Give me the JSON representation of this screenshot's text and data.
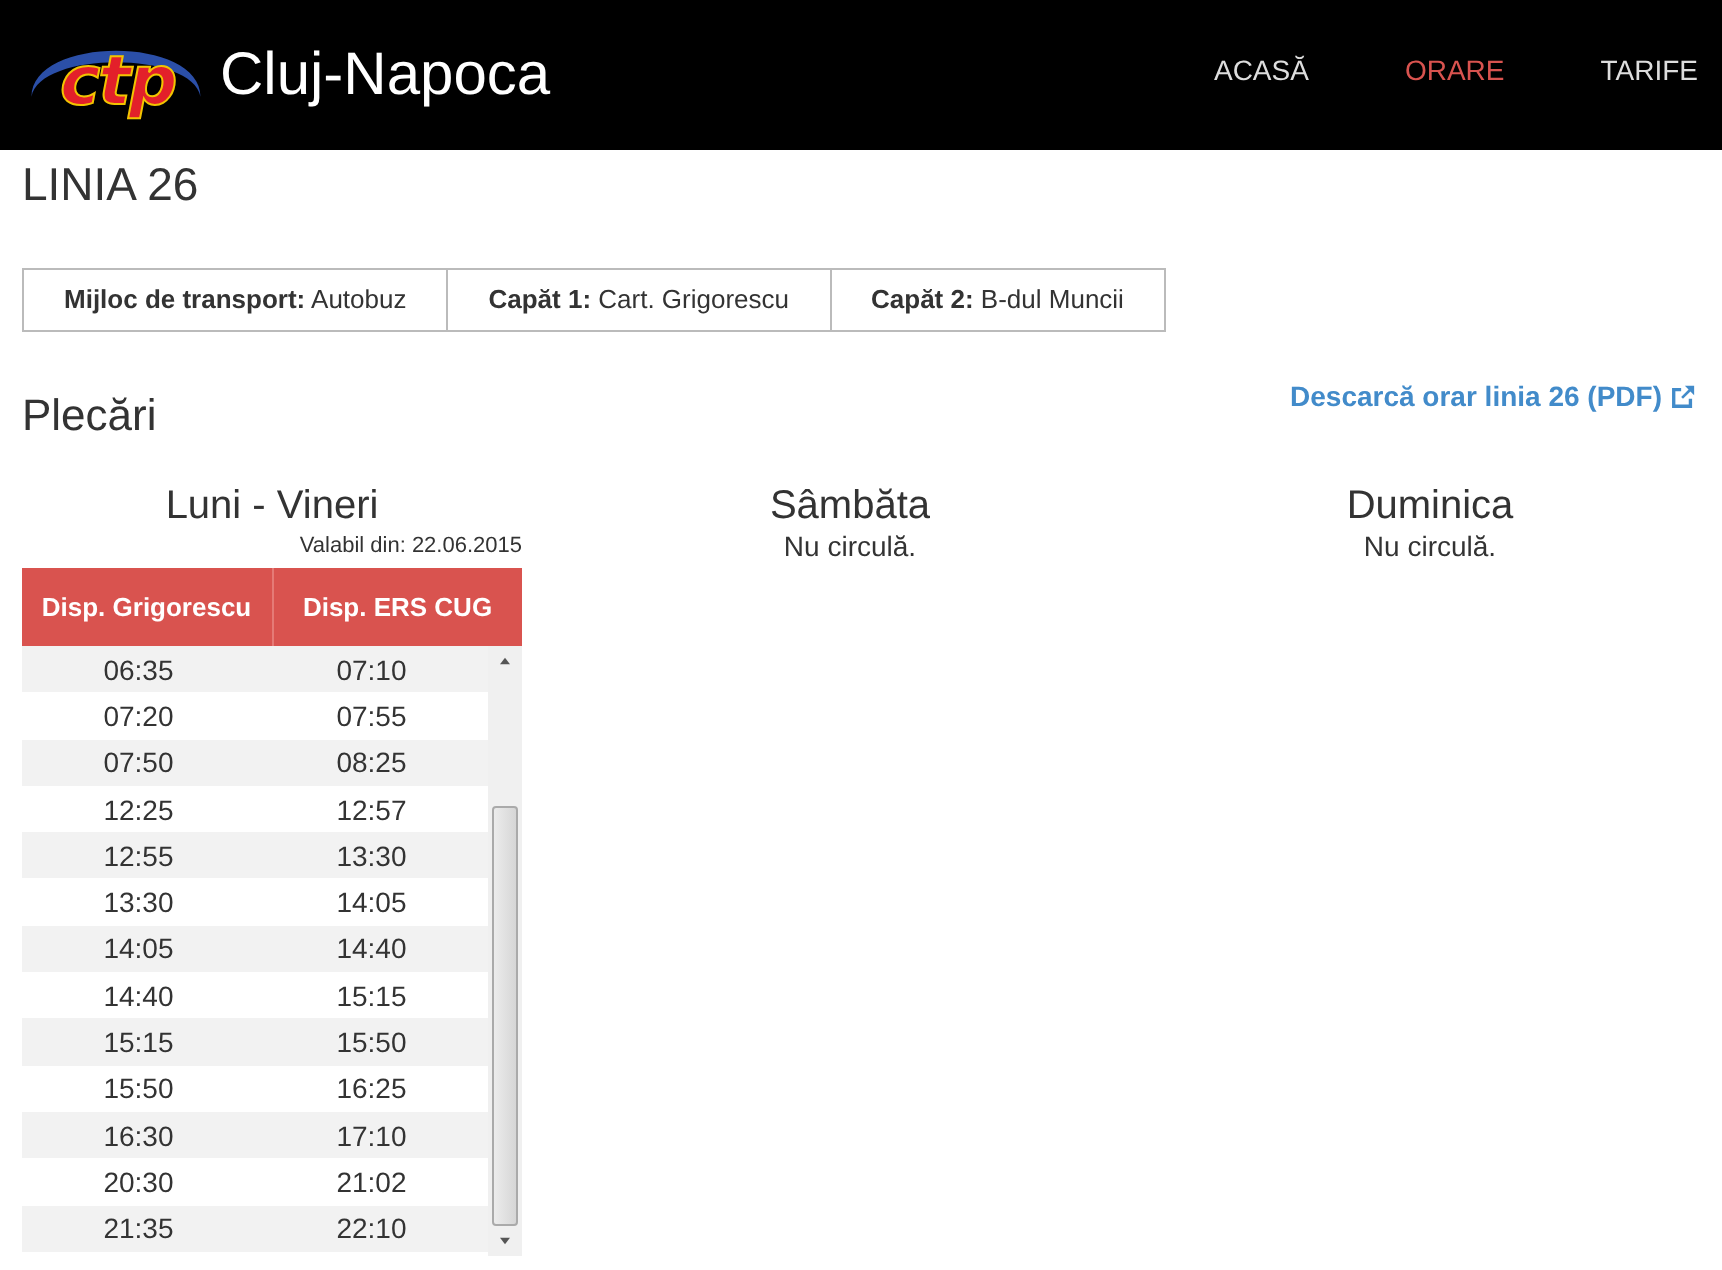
{
  "header": {
    "logo_text": "ctp",
    "brand": "Cluj-Napoca",
    "nav": [
      {
        "label": "ACASĂ",
        "selected": false
      },
      {
        "label": "ORARE",
        "selected": true
      },
      {
        "label": "TARIFE",
        "selected": false
      }
    ]
  },
  "title": "LINIA 26",
  "info": [
    "**Mijloc de transport:** Autobuz",
    "**Capăt 1:** Cart. Grigorescu",
    "**Capăt 2:** B-dul Muncii"
  ],
  "departures": {
    "heading": "Plecări",
    "download_link": "Descarcă orar linia 26 (PDF)",
    "days": [
      {
        "kind": "table",
        "name": "Luni - Vineri",
        "valid_from": "Valabil din: 22.06.2015",
        "columns": [
          "Disp. Grigorescu",
          "Disp. ERS CUG"
        ],
        "rows": [
          [
            "06:35",
            "07:10"
          ],
          [
            "07:20",
            "07:55"
          ],
          [
            "07:50",
            "08:25"
          ],
          [
            "12:25",
            "12:57"
          ],
          [
            "12:55",
            "13:30"
          ],
          [
            "13:30",
            "14:05"
          ],
          [
            "14:05",
            "14:40"
          ],
          [
            "14:40",
            "15:15"
          ],
          [
            "15:15",
            "15:50"
          ],
          [
            "15:50",
            "16:25"
          ],
          [
            "16:30",
            "17:10"
          ],
          [
            "20:30",
            "21:02"
          ],
          [
            "21:35",
            "22:10"
          ]
        ]
      },
      {
        "kind": "note",
        "name": "Sâmbăta",
        "note": "Nu circulă."
      },
      {
        "kind": "note",
        "name": "Duminica",
        "note": "Nu circulă."
      }
    ]
  }
}
